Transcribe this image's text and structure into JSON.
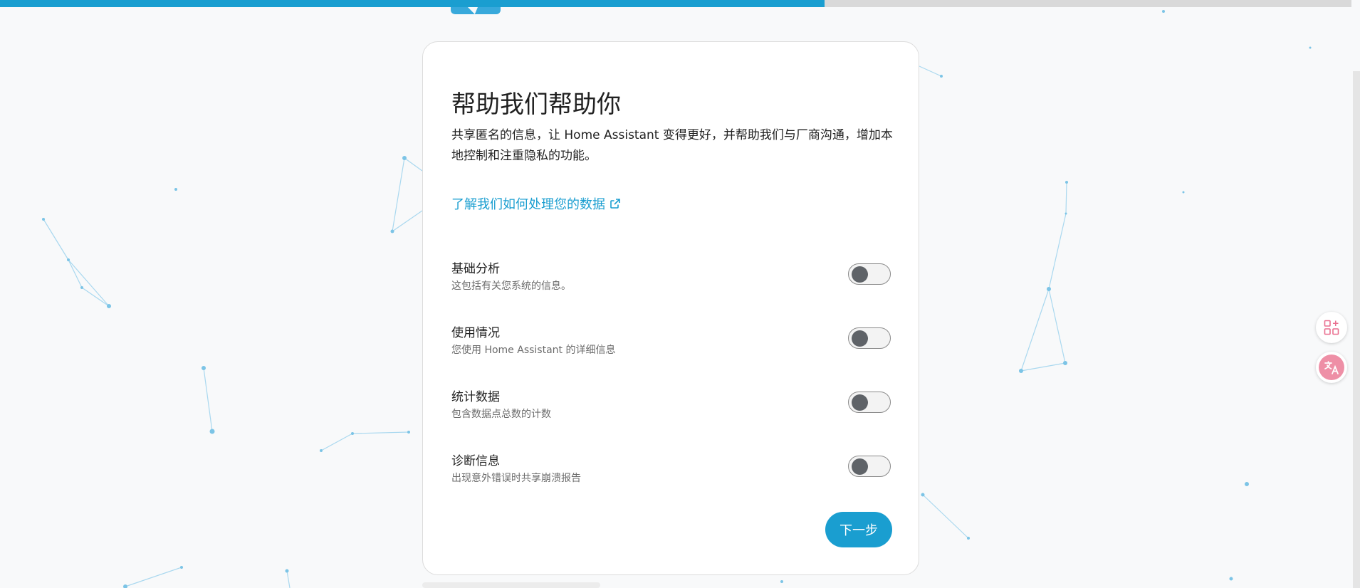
{
  "progress": {
    "fraction": 0.61,
    "fill_color": "#1a9ed0"
  },
  "card": {
    "title": "帮助我们帮助你",
    "description": "共享匿名的信息，让 Home Assistant 变得更好，并帮助我们与厂商沟通，增加本地控制和注重隐私的功能。",
    "learn_link": "了解我们如何处理您的数据"
  },
  "options": [
    {
      "title": "基础分析",
      "subtitle": "这包括有关您系统的信息。",
      "enabled": false
    },
    {
      "title": "使用情况",
      "subtitle": "您使用 Home Assistant 的详细信息",
      "enabled": false
    },
    {
      "title": "统计数据",
      "subtitle": "包含数据点总数的计数",
      "enabled": false
    },
    {
      "title": "诊断信息",
      "subtitle": "出现意外错误时共享崩溃报告",
      "enabled": false
    }
  ],
  "next_button": {
    "label": "下一步"
  },
  "floating_buttons": [
    {
      "icon": "apps-add-icon"
    },
    {
      "icon": "translate-icon"
    }
  ],
  "colors": {
    "accent": "#1a9ed0",
    "background": "#f8f9fa",
    "network": "#7cc4e6"
  }
}
